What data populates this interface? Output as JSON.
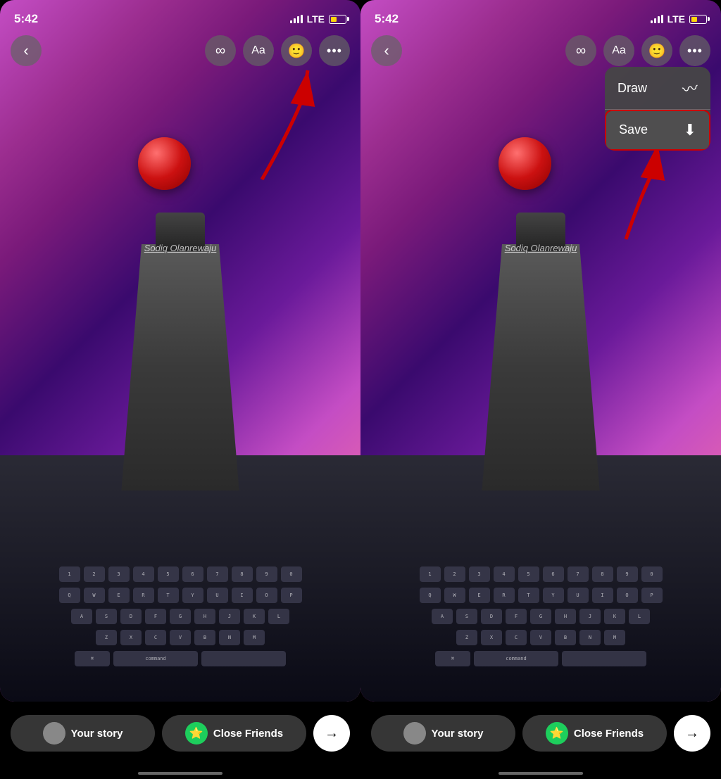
{
  "left_screen": {
    "status": {
      "time": "5:42",
      "lte": "LTE"
    },
    "toolbar": {
      "back_label": "‹",
      "infinity_label": "∞",
      "text_label": "Aa",
      "sticker_label": "☺",
      "more_label": "···"
    },
    "watermark": "Sodiq Olanrewaju",
    "bottom": {
      "your_story": "Your story",
      "close_friends": "Close Friends",
      "arrow": "→"
    }
  },
  "right_screen": {
    "status": {
      "time": "5:42",
      "lte": "LTE"
    },
    "toolbar": {
      "back_label": "‹",
      "infinity_label": "∞",
      "text_label": "Aa",
      "sticker_label": "☺",
      "more_label": "···"
    },
    "watermark": "Sodiq Olanrewaju",
    "dropdown": {
      "draw_label": "Draw",
      "save_label": "Save"
    },
    "bottom": {
      "your_story": "Your story",
      "close_friends": "Close Friends",
      "arrow": "→"
    }
  }
}
